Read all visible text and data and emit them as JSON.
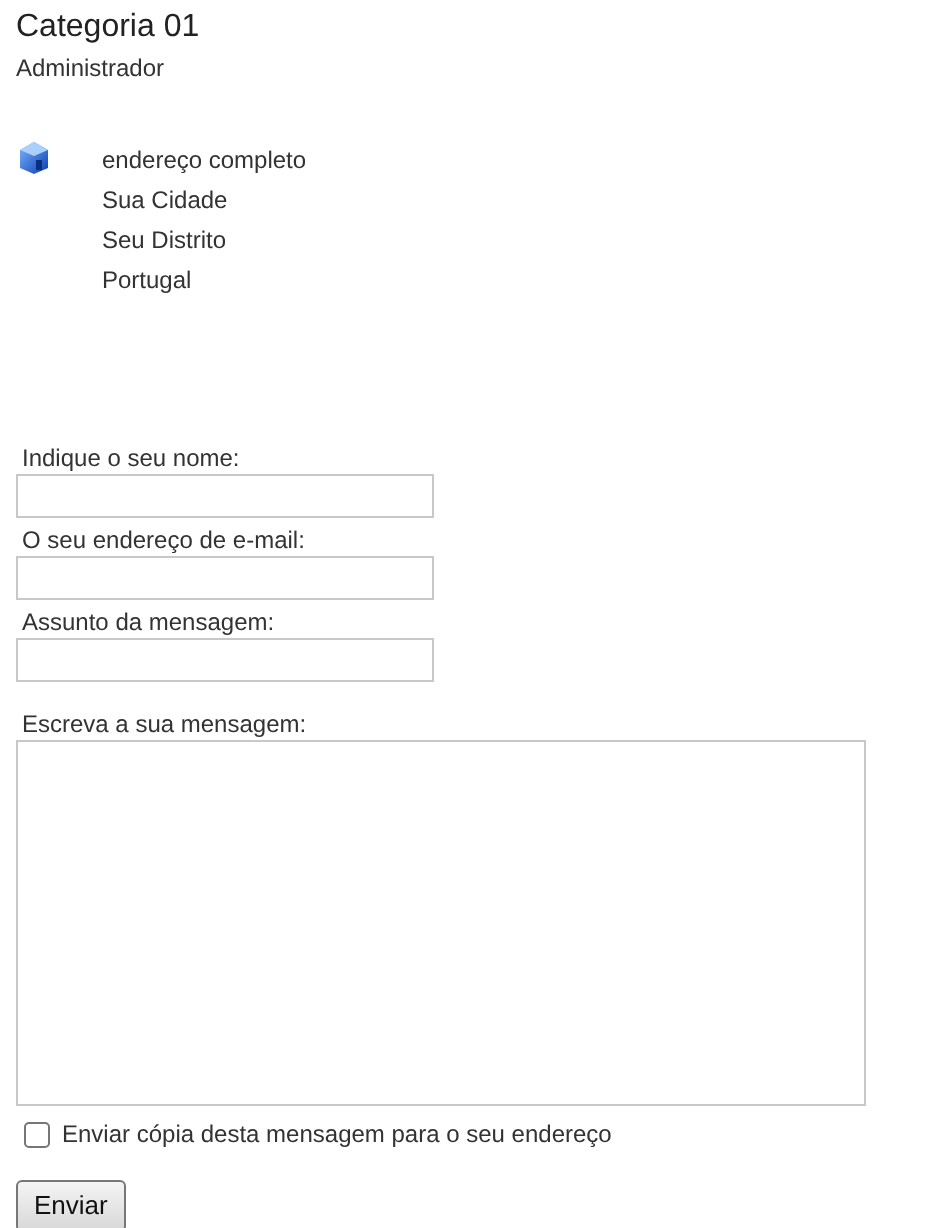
{
  "title": "Categoria 01",
  "subtitle": "Administrador",
  "address": [
    "endereço completo",
    "Sua Cidade",
    "Seu Distrito",
    "Portugal"
  ],
  "fields": [
    {
      "kind": "input",
      "label": "Indique o seu nome:"
    },
    {
      "kind": "input",
      "label": "O seu endereço de e-mail:"
    },
    {
      "kind": "input",
      "label": "Assunto da mensagem:"
    },
    {
      "kind": "textarea",
      "label": "Escreva a sua mensagem:"
    }
  ],
  "copy_option": {
    "label": "Enviar cópia desta mensagem para o seu endereço",
    "checked": false
  },
  "submit": "Enviar"
}
